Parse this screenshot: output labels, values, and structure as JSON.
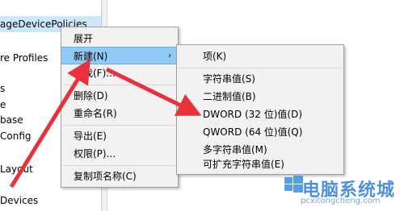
{
  "tree": {
    "items": [
      "ageDevicePolicies",
      "re Profiles",
      "s",
      "e",
      "base",
      "Config",
      "Layout",
      "Devices"
    ]
  },
  "menu_main": {
    "items": [
      {
        "label": "展开"
      },
      {
        "label": "新建(N)"
      },
      {
        "label": "查找(F)..."
      },
      {
        "label": "删除(D)"
      },
      {
        "label": "重命名(R)"
      },
      {
        "label": "导出(E)"
      },
      {
        "label": "权限(P)..."
      },
      {
        "label": "复制项名称(C)"
      }
    ],
    "chevron": "›"
  },
  "menu_new": {
    "items": [
      {
        "label": "项(K)"
      },
      {
        "label": "字符串值(S)"
      },
      {
        "label": "二进制值(B)"
      },
      {
        "label": "DWORD (32 位)值(D)"
      },
      {
        "label": "QWORD (64 位)值(Q)"
      },
      {
        "label": "多字符串值(M)"
      },
      {
        "label": "可扩充字符串值(E)"
      }
    ]
  },
  "watermark": {
    "title": "电脑系统城",
    "url": "pcxitongcheng.com"
  },
  "colors": {
    "arrow": "#e8313a",
    "highlight": "#91c9f7",
    "selection": "#cce8ff",
    "menu_bg": "#f2f2f2"
  }
}
